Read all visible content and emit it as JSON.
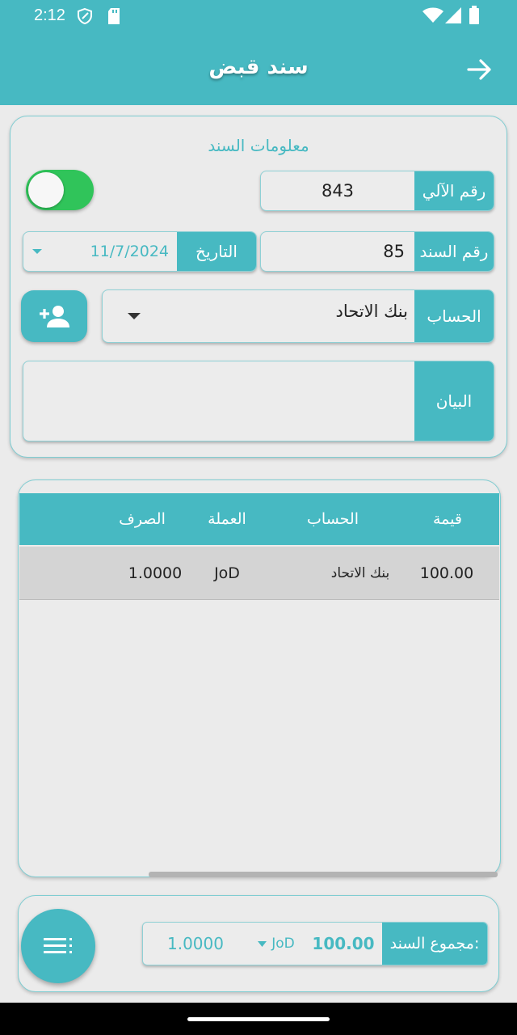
{
  "status_bar": {
    "time": "2:12"
  },
  "app_bar": {
    "title": "سند قبض"
  },
  "voucher_info": {
    "section_title": "معلومات السند",
    "auto_number_label": "رقم الآلي",
    "auto_number_value": "843",
    "voucher_number_label": "رقم السند",
    "voucher_number_value": "85",
    "date_label": "التاريخ",
    "date_value": "11/7/2024",
    "account_label": "الحساب",
    "account_value": "بنك الاتحاد",
    "description_label": "البيان",
    "description_value": ""
  },
  "table": {
    "columns": [
      "قيمة",
      "الحساب",
      "العملة",
      "الصرف"
    ],
    "rows": [
      {
        "value": "100.00",
        "account": "بنك الاتحاد",
        "currency": "JoD",
        "rate": "1.0000"
      }
    ]
  },
  "footer": {
    "total_label": "مجموع السند:",
    "total_value": "100.00",
    "currency": "JoD",
    "rate": "1.0000"
  },
  "colors": {
    "accent": "#47b9c2",
    "toggle_on": "#30c45a",
    "row_bg": "#d4d4d4"
  },
  "icons": [
    "shield-icon",
    "sd-card-icon",
    "wifi-icon",
    "signal-icon",
    "battery-icon",
    "arrow-forward-icon",
    "dropdown-arrow-icon",
    "add-person-icon",
    "list-menu-icon"
  ]
}
